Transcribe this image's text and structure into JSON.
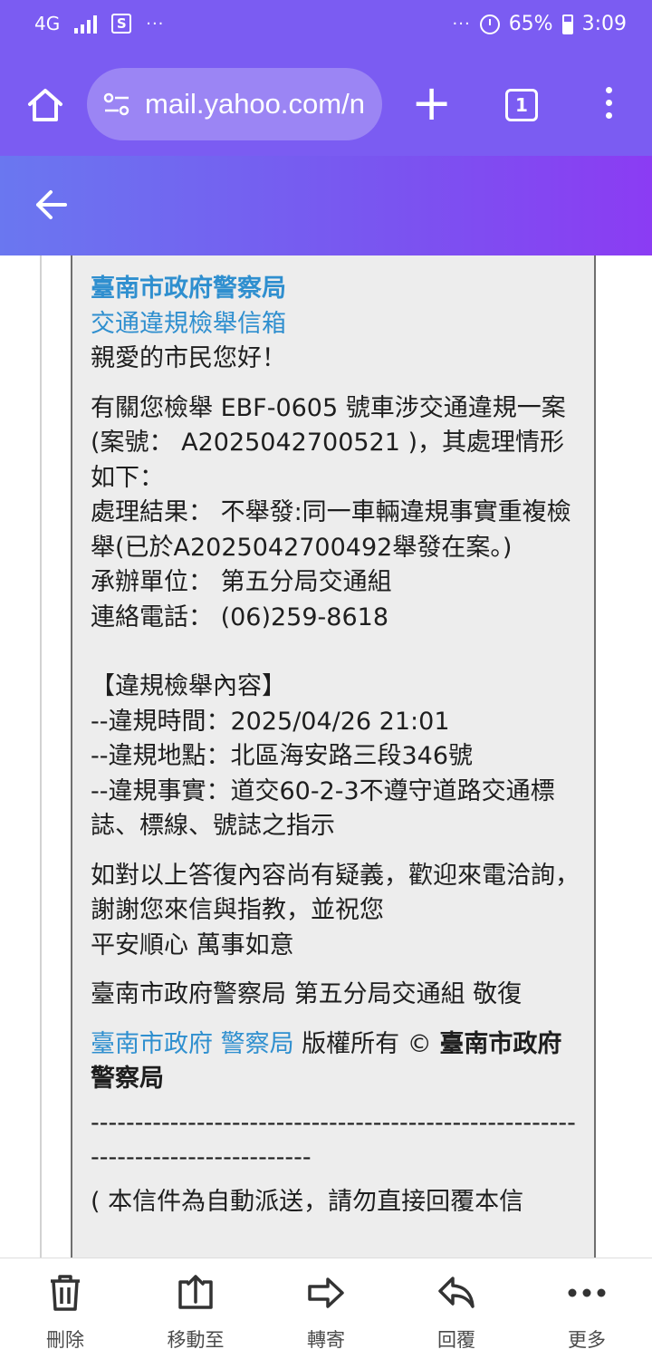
{
  "status_bar": {
    "network": "4G",
    "more": "···",
    "more_right": "···",
    "battery": "65%",
    "time": "3:09"
  },
  "browser": {
    "url": "mail.yahoo.com/n",
    "tab_count": "1"
  },
  "email": {
    "org_name": "臺南市政府警察局",
    "mailbox_name": "交通違規檢舉信箱",
    "greeting": "親愛的市民您好！",
    "intro": "有關您檢舉 EBF-0605 號車涉交通違規一案 (案號： A2025042700521 )，其處理情形如下：",
    "result": "處理結果： 不舉發:同一車輛違規事實重複檢舉(已於A2025042700492舉發在案。)",
    "unit": "承辦單位： 第五分局交通組",
    "phone": "連絡電話： (06)259-8618",
    "report_heading": "【違規檢舉內容】",
    "violation_time": "--違規時間：2025/04/26 21:01",
    "violation_place": "--違規地點：北區海安路三段346號",
    "violation_fact": "--違規事實：道交60-2-3不遵守道路交通標誌、標線、號誌之指示",
    "closing": "如對以上答復內容尚有疑義，歡迎來電洽詢，謝謝您來信與指教，並祝您",
    "wishes": "平安順心 萬事如意",
    "signature": "臺南市政府警察局 第五分局交通組 敬復",
    "footer_link_city": "臺南市政府",
    "footer_link_police": "警察局",
    "footer_rights": " 版權所有 © ",
    "footer_bold": "臺南市政府警察局",
    "divider": "--------------------------------------------------------------------------------",
    "auto_notice": "( 本信件為自動派送，請勿直接回覆本信"
  },
  "toolbar": {
    "items": [
      {
        "icon": "trash-icon",
        "label": "刪除"
      },
      {
        "icon": "move-to-icon",
        "label": "移動至"
      },
      {
        "icon": "forward-icon",
        "label": "轉寄"
      },
      {
        "icon": "reply-icon",
        "label": "回覆"
      },
      {
        "icon": "more-icon",
        "label": "更多"
      }
    ]
  },
  "colors": {
    "header_purple": "#7b5cf2",
    "link_blue": "#2f8fcf",
    "card_bg": "#ededed"
  }
}
